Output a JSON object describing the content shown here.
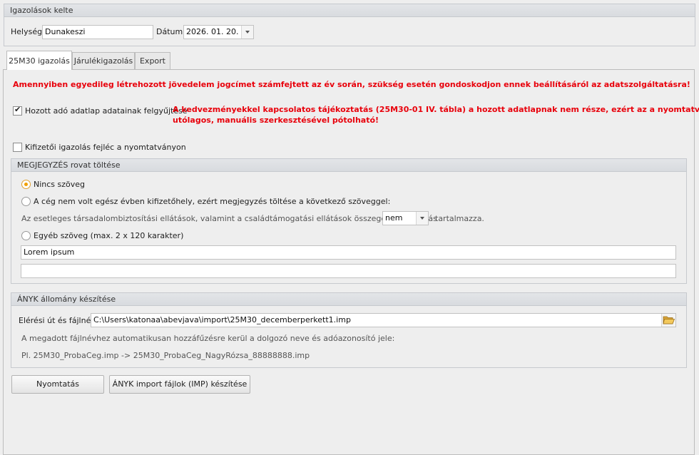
{
  "header": {
    "group_title": "Igazolások kelte",
    "place_label": "Helység",
    "place_value": "Dunakeszi",
    "date_label": "Dátum",
    "date_value": "2026. 01. 20."
  },
  "tabs": [
    {
      "label": "25M30 igazolás",
      "active": true
    },
    {
      "label": "Járulékigazolás",
      "active": false
    },
    {
      "label": "Export",
      "active": false
    }
  ],
  "main": {
    "warning_main": "Amennyiben egyedileg létrehozott jövedelem jogcímet számfejtett az év során, szükség esetén gondoskodjon ennek beállításáról az adatszolgáltatásra!",
    "collect_checkbox_label": "Hozott adó adatlap adatainak felgyűjtése",
    "collect_checked": true,
    "warning_collect_line1": "A kedvezményekkel kapcsolatos tájékoztatás (25M30-01 IV. tábla) a hozott adatlapnak nem része, ezért az a nyomtatvány",
    "warning_collect_line2": "utólagos, manuális szerkesztésével pótolható!",
    "payer_header_label": "Kifizetői igazolás fejléc a nyomtatványon",
    "payer_header_checked": false
  },
  "remark": {
    "title": "MEGJEGYZÉS rovat töltése",
    "option_none": "Nincs szöveg",
    "option_company": "A cég nem volt egész évben kifizetőhely, ezért megjegyzés töltése a következő szöveggel:",
    "sentence_before": "Az esetleges társadalombiztosítási ellátások, valamint a családtámogatási ellátások összegeit az igazolás",
    "combo_value": "nem",
    "sentence_after": "tartalmazza.",
    "option_other": "Egyéb szöveg (max. 2 x 120 karakter)",
    "text_line1": "Lorem ipsum",
    "text_line2": "",
    "selected": "none"
  },
  "anyk": {
    "title": "ÁNYK állomány készítése",
    "path_label": "Elérési út és fájlnév",
    "path_value": "C:\\Users\\katonaa\\abevjava\\import\\25M30_decemberperkett1.imp",
    "info_line": "A megadott fájlnévhez automatikusan hozzáfűzésre kerül a dolgozó neve és adóazonosító jele:",
    "example_line": "Pl. 25M30_ProbaCeg.imp -> 25M30_ProbaCeg_NagyRózsa_88888888.imp"
  },
  "buttons": {
    "print_label": "Nyomtatás",
    "anyk_label": "ÁNYK import fájlok (IMP) készítése"
  },
  "icons": {
    "folder": "folder-open-icon",
    "dropdown": "chevron-down-icon"
  },
  "colors": {
    "warning": "#e8000b",
    "radio_selected": "#f0a000",
    "folder": "#e8b84a"
  }
}
